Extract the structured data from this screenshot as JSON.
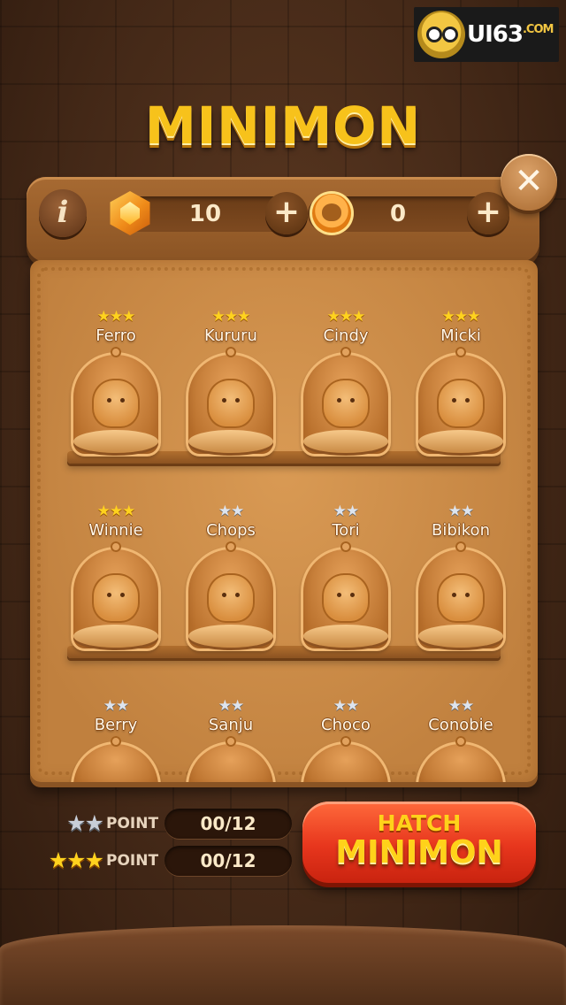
{
  "watermark": {
    "text": "UI63",
    "suffix": ".COM"
  },
  "title": "MINIMON",
  "currencies": {
    "gems": {
      "icon": "gem-icon",
      "value": "10"
    },
    "coins": {
      "icon": "bear-coin-icon",
      "value": "0"
    }
  },
  "buttons": {
    "info": "i",
    "plus": "+",
    "close": "✕"
  },
  "minimons": [
    {
      "name": "Ferro",
      "stars": "★★★",
      "grade": "gold"
    },
    {
      "name": "Kururu",
      "stars": "★★★",
      "grade": "gold"
    },
    {
      "name": "Cindy",
      "stars": "★★★",
      "grade": "gold"
    },
    {
      "name": "Micki",
      "stars": "★★★",
      "grade": "gold"
    },
    {
      "name": "Winnie",
      "stars": "★★★",
      "grade": "gold"
    },
    {
      "name": "Chops",
      "stars": "★★",
      "grade": "silver"
    },
    {
      "name": "Tori",
      "stars": "★★",
      "grade": "silver"
    },
    {
      "name": "Bibikon",
      "stars": "★★",
      "grade": "silver"
    },
    {
      "name": "Berry",
      "stars": "★★",
      "grade": "silver"
    },
    {
      "name": "Sanju",
      "stars": "★★",
      "grade": "silver"
    },
    {
      "name": "Choco",
      "stars": "★★",
      "grade": "silver"
    },
    {
      "name": "Conobie",
      "stars": "★★",
      "grade": "silver"
    }
  ],
  "points": [
    {
      "stars": "★★",
      "label": "POINT",
      "value": "00/12"
    },
    {
      "stars": "★★★",
      "label": "POINT",
      "value": "00/12"
    }
  ],
  "hatch": {
    "line1": "HATCH",
    "line2": "MINIMON"
  }
}
